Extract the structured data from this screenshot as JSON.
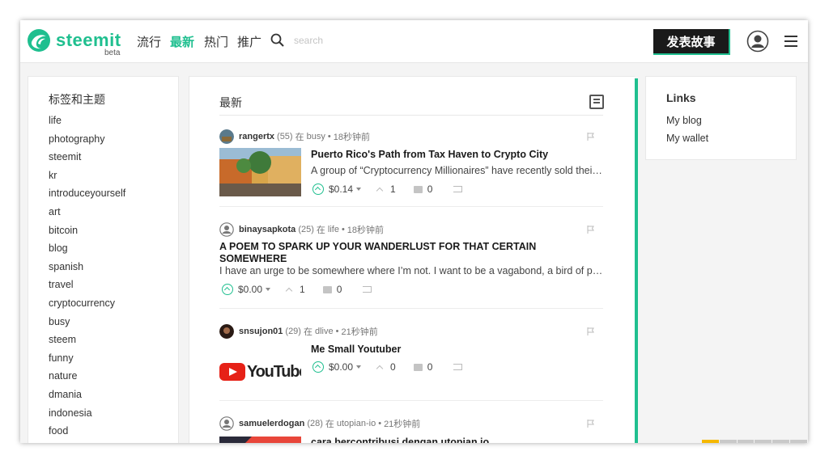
{
  "header": {
    "brand": "steemit",
    "beta": "beta",
    "nav": [
      "流行",
      "最新",
      "热门",
      "推广"
    ],
    "active_nav_index": 1,
    "search_placeholder": "search",
    "post_button": "发表故事",
    "brand_color": "#1fbf8f"
  },
  "sidebar": {
    "title": "标签和主题",
    "tags": [
      "life",
      "photography",
      "steemit",
      "kr",
      "introduceyourself",
      "art",
      "bitcoin",
      "blog",
      "spanish",
      "travel",
      "cryptocurrency",
      "busy",
      "steem",
      "funny",
      "nature",
      "dmania",
      "indonesia",
      "food"
    ]
  },
  "feed": {
    "title": "最新",
    "in_word": "在",
    "posts": [
      {
        "author": "rangertx",
        "rep": "(55)",
        "category": "busy",
        "time": "18秒钟前",
        "title": "Puerto Rico's Path from Tax Haven to Crypto City",
        "excerpt": "A group of “Cryptocurrency Millionaires” have recently sold their house and moved to Puerto Rico",
        "payout": "$0.14",
        "votes": "1",
        "comments": "0",
        "thumb": "photo"
      },
      {
        "author": "binaysapkota",
        "rep": "(25)",
        "category": "life",
        "time": "18秒钟前",
        "title": "A POEM TO SPARK UP YOUR WANDERLUST FOR THAT CERTAIN SOMEWHERE",
        "excerpt": "I have an urge to be somewhere where I’m not. I want to be a vagabond, a bird of passage",
        "payout": "$0.00",
        "votes": "1",
        "comments": "0",
        "thumb": "none"
      },
      {
        "author": "snsujon01",
        "rep": "(29)",
        "category": "dlive",
        "time": "21秒钟前",
        "title": "Me Small Youtuber",
        "excerpt": "",
        "payout": "$0.00",
        "votes": "0",
        "comments": "0",
        "thumb": "youtube",
        "thumb_text": "YouTube"
      },
      {
        "author": "samuelerdogan",
        "rep": "(28)",
        "category": "utopian-io",
        "time": "21秒钟前",
        "title": "cara bercontribusi dengan utopian.io",
        "excerpt": "",
        "payout": "",
        "votes": "",
        "comments": "",
        "thumb": "graphic"
      }
    ]
  },
  "links": {
    "title": "Links",
    "items": [
      "My blog",
      "My wallet"
    ]
  }
}
